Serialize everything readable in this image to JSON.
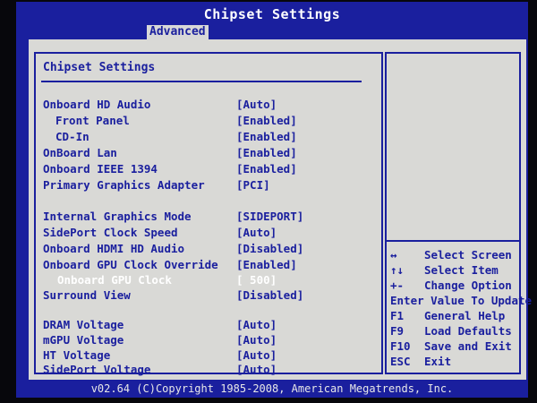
{
  "window": {
    "title": "Chipset Settings"
  },
  "tabs": [
    {
      "label": "Advanced",
      "active": true
    }
  ],
  "section": {
    "title": "Chipset Settings"
  },
  "settings": [
    {
      "label": "Onboard HD Audio",
      "value": "[Auto]"
    },
    {
      "label": "Front Panel",
      "value": "[Enabled]"
    },
    {
      "label": "CD-In",
      "value": "[Enabled]"
    },
    {
      "label": "OnBoard Lan",
      "value": "[Enabled]"
    },
    {
      "label": "Onboard IEEE 1394",
      "value": "[Enabled]"
    },
    {
      "label": "Primary Graphics Adapter",
      "value": "[PCI]"
    },
    {
      "label": "Internal Graphics Mode",
      "value": "[SIDEPORT]"
    },
    {
      "label": "SidePort Clock Speed",
      "value": "[Auto]"
    },
    {
      "label": "Onboard HDMI HD Audio",
      "value": "[Disabled]"
    },
    {
      "label": "Onboard GPU Clock Override",
      "value": "[Enabled]"
    },
    {
      "label": "Onboard GPU Clock",
      "value": "[ 500]",
      "selected": true
    },
    {
      "label": "Surround View",
      "value": "[Disabled]"
    },
    {
      "label": "DRAM Voltage",
      "value": "[Auto]"
    },
    {
      "label": "mGPU Voltage",
      "value": "[Auto]"
    },
    {
      "label": "HT Voltage",
      "value": "[Auto]"
    },
    {
      "label": "SidePort Voltage",
      "value": "[Auto]"
    }
  ],
  "help_keys": [
    {
      "key": "↔",
      "desc": "Select Screen"
    },
    {
      "key": "↑↓",
      "desc": "Select Item"
    },
    {
      "key": "+-",
      "desc": "Change Option"
    },
    {
      "key": "",
      "desc": "Enter Value To Update"
    },
    {
      "key": "F1",
      "desc": "General Help"
    },
    {
      "key": "F9",
      "desc": "Load Defaults"
    },
    {
      "key": "F10",
      "desc": "Save and Exit"
    },
    {
      "key": "ESC",
      "desc": "Exit"
    }
  ],
  "footer": {
    "text": "v02.64 (C)Copyright 1985-2008, American Megatrends, Inc."
  },
  "colors": {
    "background_blue": "#1a1f9e",
    "panel_gray": "#d9d9d6",
    "selected_text": "#ffffff"
  }
}
